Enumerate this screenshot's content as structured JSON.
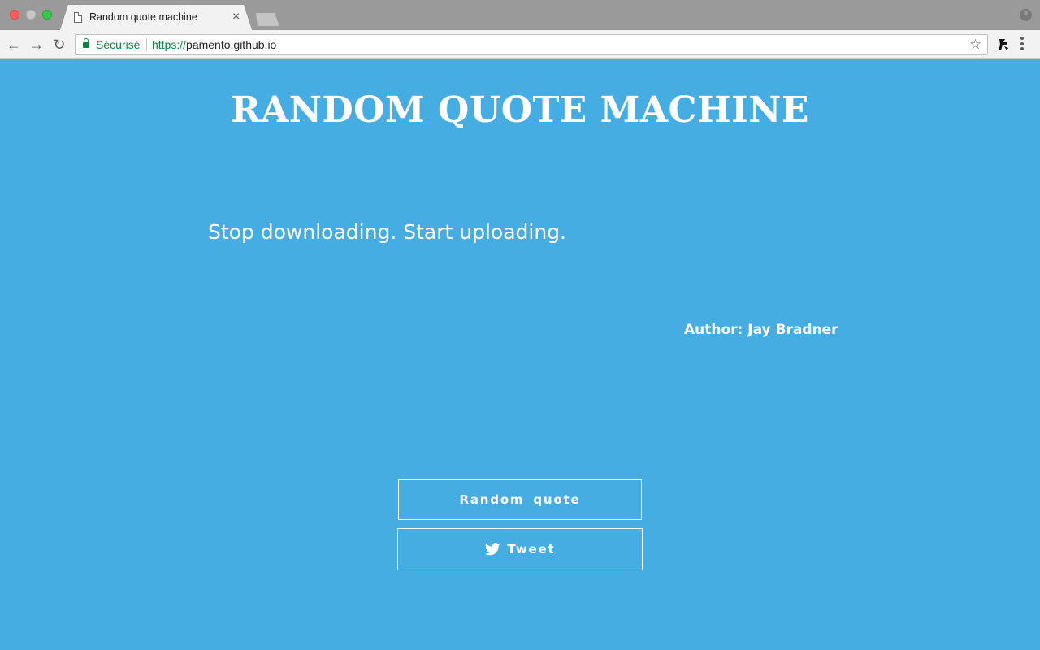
{
  "browser": {
    "tab": {
      "title": "Random quote machine",
      "close_glyph": "×"
    },
    "toolbar": {
      "back_glyph": "←",
      "forward_glyph": "→",
      "reload_glyph": "↻",
      "secure_label": "Sécurisé",
      "url_scheme": "https://",
      "url_host": "pamento.github.io",
      "bookmark_glyph": "☆"
    },
    "colors": {
      "secure_green": "#0b8043",
      "chrome_gray": "#9a9a9a"
    }
  },
  "page": {
    "heading": "Random quote machine",
    "quote": "Stop downloading. Start uploading.",
    "author": "Author: Jay Bradner",
    "buttons": {
      "random_label": "Random quote",
      "tweet_label": "Tweet",
      "tweet_icon": "twitter-bird-icon"
    },
    "colors": {
      "background": "#46ade3",
      "text": "#ffffff"
    }
  }
}
